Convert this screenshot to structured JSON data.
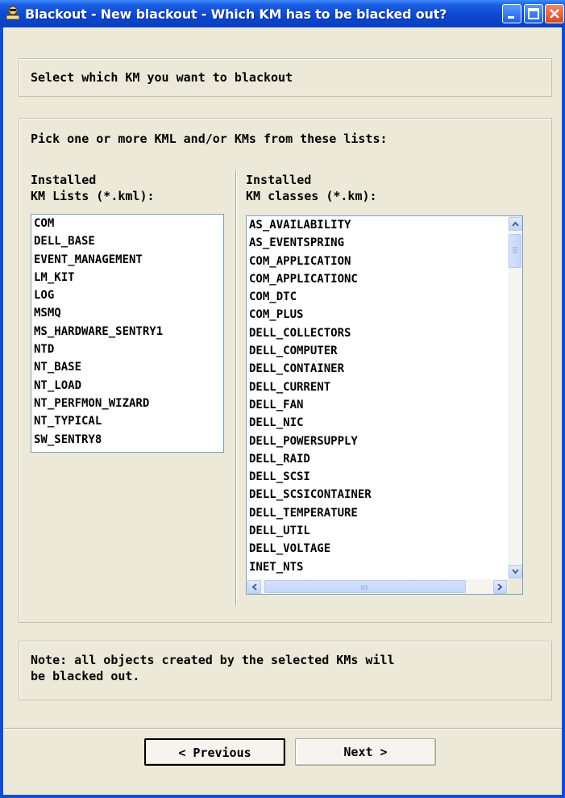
{
  "window": {
    "title": "Blackout - New blackout - Which KM has to be blacked out?",
    "icon": "blackout-app-icon"
  },
  "header": {
    "instruction": "Select which KM you want to blackout"
  },
  "selection": {
    "prompt": "Pick one or more KML and/or KMs from these lists:",
    "kml_label_line1": "Installed",
    "kml_label_line2": "KM Lists (*.kml):",
    "km_label_line1": "Installed",
    "km_label_line2": "KM classes (*.km):",
    "kml_items": [
      "COM",
      "DELL_BASE",
      "EVENT_MANAGEMENT",
      "LM_KIT",
      "LOG",
      "MSMQ",
      "MS_HARDWARE_SENTRY1",
      "NTD",
      "NT_BASE",
      "NT_LOAD",
      "NT_PERFMON_WIZARD",
      "NT_TYPICAL",
      "SW_SENTRY8"
    ],
    "km_items": [
      "AS_AVAILABILITY",
      "AS_EVENTSPRING",
      "COM_APPLICATION",
      "COM_APPLICATIONC",
      "COM_DTC",
      "COM_PLUS",
      "DELL_COLLECTORS",
      "DELL_COMPUTER",
      "DELL_CONTAINER",
      "DELL_CURRENT",
      "DELL_FAN",
      "DELL_NIC",
      "DELL_POWERSUPPLY",
      "DELL_RAID",
      "DELL_SCSI",
      "DELL_SCSICONTAINER",
      "DELL_TEMPERATURE",
      "DELL_UTIL",
      "DELL_VOLTAGE",
      "INET_NTS"
    ]
  },
  "note": {
    "line1": "Note: all objects created by the selected KMs will",
    "line2": "be blacked out."
  },
  "buttons": {
    "previous": "< Previous",
    "next": "Next >"
  },
  "colors": {
    "titlebar": "#0a3fc0",
    "dialog_bg": "#ece9d8",
    "close_button": "#d9461f"
  }
}
